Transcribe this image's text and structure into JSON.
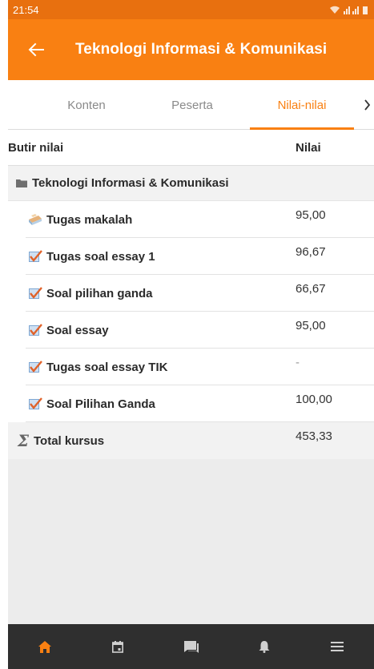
{
  "status_bar": {
    "time": "21:54"
  },
  "app_bar": {
    "title": "Teknologi Informasi & Komunikasi"
  },
  "tabs": [
    {
      "label": "Konten",
      "active": false
    },
    {
      "label": "Peserta",
      "active": false
    },
    {
      "label": "Nilai-nilai",
      "active": true
    }
  ],
  "grades": {
    "header_item": "Butir nilai",
    "header_grade": "Nilai",
    "category": "Teknologi Informasi & Komunikasi",
    "items": [
      {
        "name": "Tugas makalah",
        "grade": "95,00",
        "icon": "assignment-icon"
      },
      {
        "name": "Tugas soal essay 1",
        "grade": "96,67",
        "icon": "quiz-icon"
      },
      {
        "name": "Soal pilihan ganda",
        "grade": "66,67",
        "icon": "quiz-icon"
      },
      {
        "name": "Soal essay",
        "grade": "95,00",
        "icon": "quiz-icon"
      },
      {
        "name": "Tugas soal essay TIK",
        "grade": "-",
        "icon": "quiz-icon"
      },
      {
        "name": "Soal Pilihan Ganda",
        "grade": "100,00",
        "icon": "quiz-icon"
      }
    ],
    "total": {
      "name": "Total kursus",
      "grade": "453,33",
      "icon": "sigma-icon"
    }
  },
  "bottom_nav": [
    {
      "name": "home-icon",
      "active": true
    },
    {
      "name": "calendar-icon",
      "active": false
    },
    {
      "name": "messages-icon",
      "active": false
    },
    {
      "name": "notifications-icon",
      "active": false
    },
    {
      "name": "menu-icon",
      "active": false
    }
  ],
  "colors": {
    "accent": "#f98012",
    "status_bar": "#e8700f",
    "nav_bar": "#2f2f2f"
  }
}
